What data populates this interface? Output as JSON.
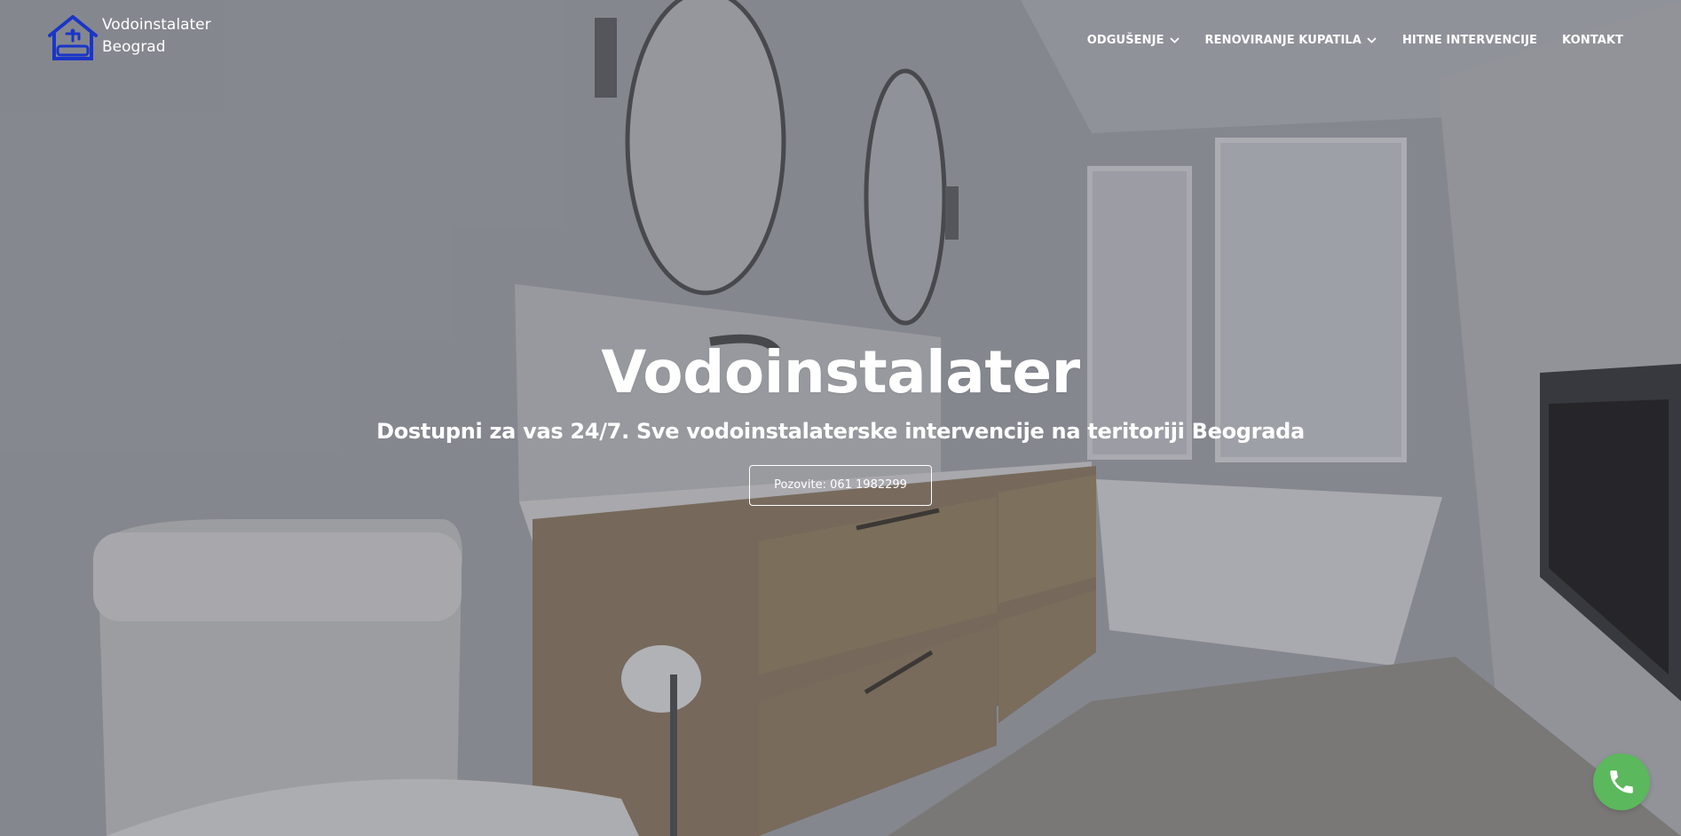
{
  "brand": {
    "name_line1": "Vodoinstalater",
    "name_line2": "Beograd",
    "logo_icon": "house-faucet-icon",
    "logo_color": "#1a35c8"
  },
  "nav": {
    "items": [
      {
        "label": "ODGUŠENJE",
        "has_dropdown": true
      },
      {
        "label": "RENOVIRANJE KUPATILA",
        "has_dropdown": true
      },
      {
        "label": "HITNE INTERVENCIJE",
        "has_dropdown": false
      },
      {
        "label": "KONTAKT",
        "has_dropdown": false
      }
    ]
  },
  "hero": {
    "title": "Vodoinstalater",
    "subtitle": "Dostupni za vas 24/7. Sve vodoinstalaterske intervencije na teritoriji Beograda",
    "cta_label": "Pozovite: 061 1982299",
    "background_image": "bathroom-interior"
  },
  "call_button": {
    "icon": "phone-icon",
    "color": "#5cb85c"
  }
}
